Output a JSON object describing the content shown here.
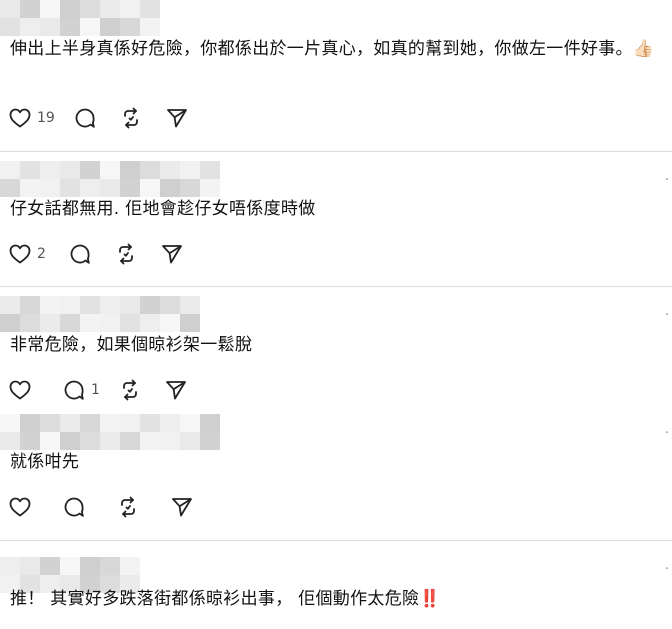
{
  "comments": [
    {
      "text": "伸出上半身真係好危險，你都係出於一片真心，如真的幫到她，你做左一件好事。",
      "emoji": "👍🏻",
      "likes": "19",
      "replies": "",
      "has_menu": false
    },
    {
      "text": "仔女話都無用. 佢地會趁仔女唔係度時做",
      "emoji": "",
      "likes": "2",
      "replies": "",
      "has_menu": true
    },
    {
      "text": "非常危險，如果個晾衫架一鬆脫",
      "emoji": "",
      "likes": "",
      "replies": "1",
      "has_menu": true
    },
    {
      "text": "就係咁先",
      "emoji": "",
      "likes": "",
      "replies": "",
      "has_menu": true
    },
    {
      "text": "推！ 其實好多跌落街都係晾衫出事， 佢個動作太危險",
      "emoji": "‼️",
      "likes": "",
      "replies": "",
      "has_menu": true
    }
  ],
  "icons": {
    "like": "heart-icon",
    "reply": "speech-bubble-icon",
    "repost": "repost-icon",
    "share": "send-icon",
    "menu": "vertical-dots-icon",
    "username_blur": "pixelated-username"
  },
  "colors": {
    "icon_stroke": "#222222",
    "separator": "#dcdcdc",
    "count_text": "#555555",
    "emoji_red": "#d21f1f"
  }
}
